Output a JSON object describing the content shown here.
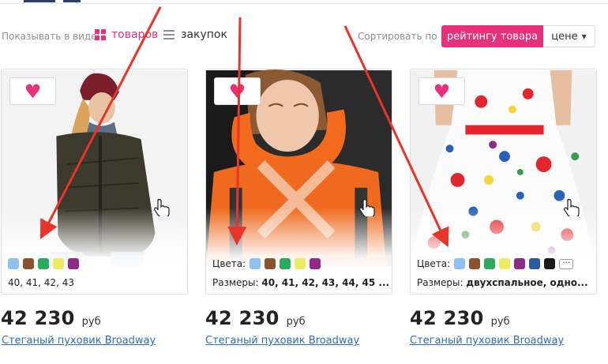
{
  "toolbar": {
    "view_label": "Показывать в виде:",
    "view_goods": "товаров",
    "view_purchases": "закупок",
    "sort_label": "Сортировать по :",
    "sort_rating": "рейтингу товара",
    "sort_price": "цене"
  },
  "products": [
    {
      "colors_label": "",
      "swatches": [
        "#8ec1f2",
        "#8a5330",
        "#2eaa5f",
        "#eaec62",
        "#8e2a87"
      ],
      "sizes_label": "",
      "sizes": "40, 41, 42, 43",
      "price": "42 230",
      "currency": "руб",
      "title": "Стеганый пуховик Broadway"
    },
    {
      "colors_label": "Цвета:",
      "swatches": [
        "#8ec1f2",
        "#8a5330",
        "#2eaa5f",
        "#eaec62",
        "#8e2a87"
      ],
      "sizes_label": "Размеры:",
      "sizes": "40, 41, 42, 43, 44, 45 ...",
      "price": "42 230",
      "currency": "руб",
      "title": "Стеганый пуховик Broadway"
    },
    {
      "colors_label": "Цвета:",
      "swatches": [
        "#8ec1f2",
        "#8a5330",
        "#2eaa5f",
        "#eaec62",
        "#8e2a87",
        "#2d5aa0",
        "#1b1b1b"
      ],
      "more_label": "···",
      "sizes_label": "Размеры:",
      "sizes": "двухспальное, одно...",
      "price": "42 230",
      "currency": "руб",
      "title": "Стеганый пуховик Broadway"
    }
  ],
  "colors": {
    "accent": "#e8317a",
    "link": "#2f6db5",
    "annotation_arrow": "#e8342a"
  }
}
